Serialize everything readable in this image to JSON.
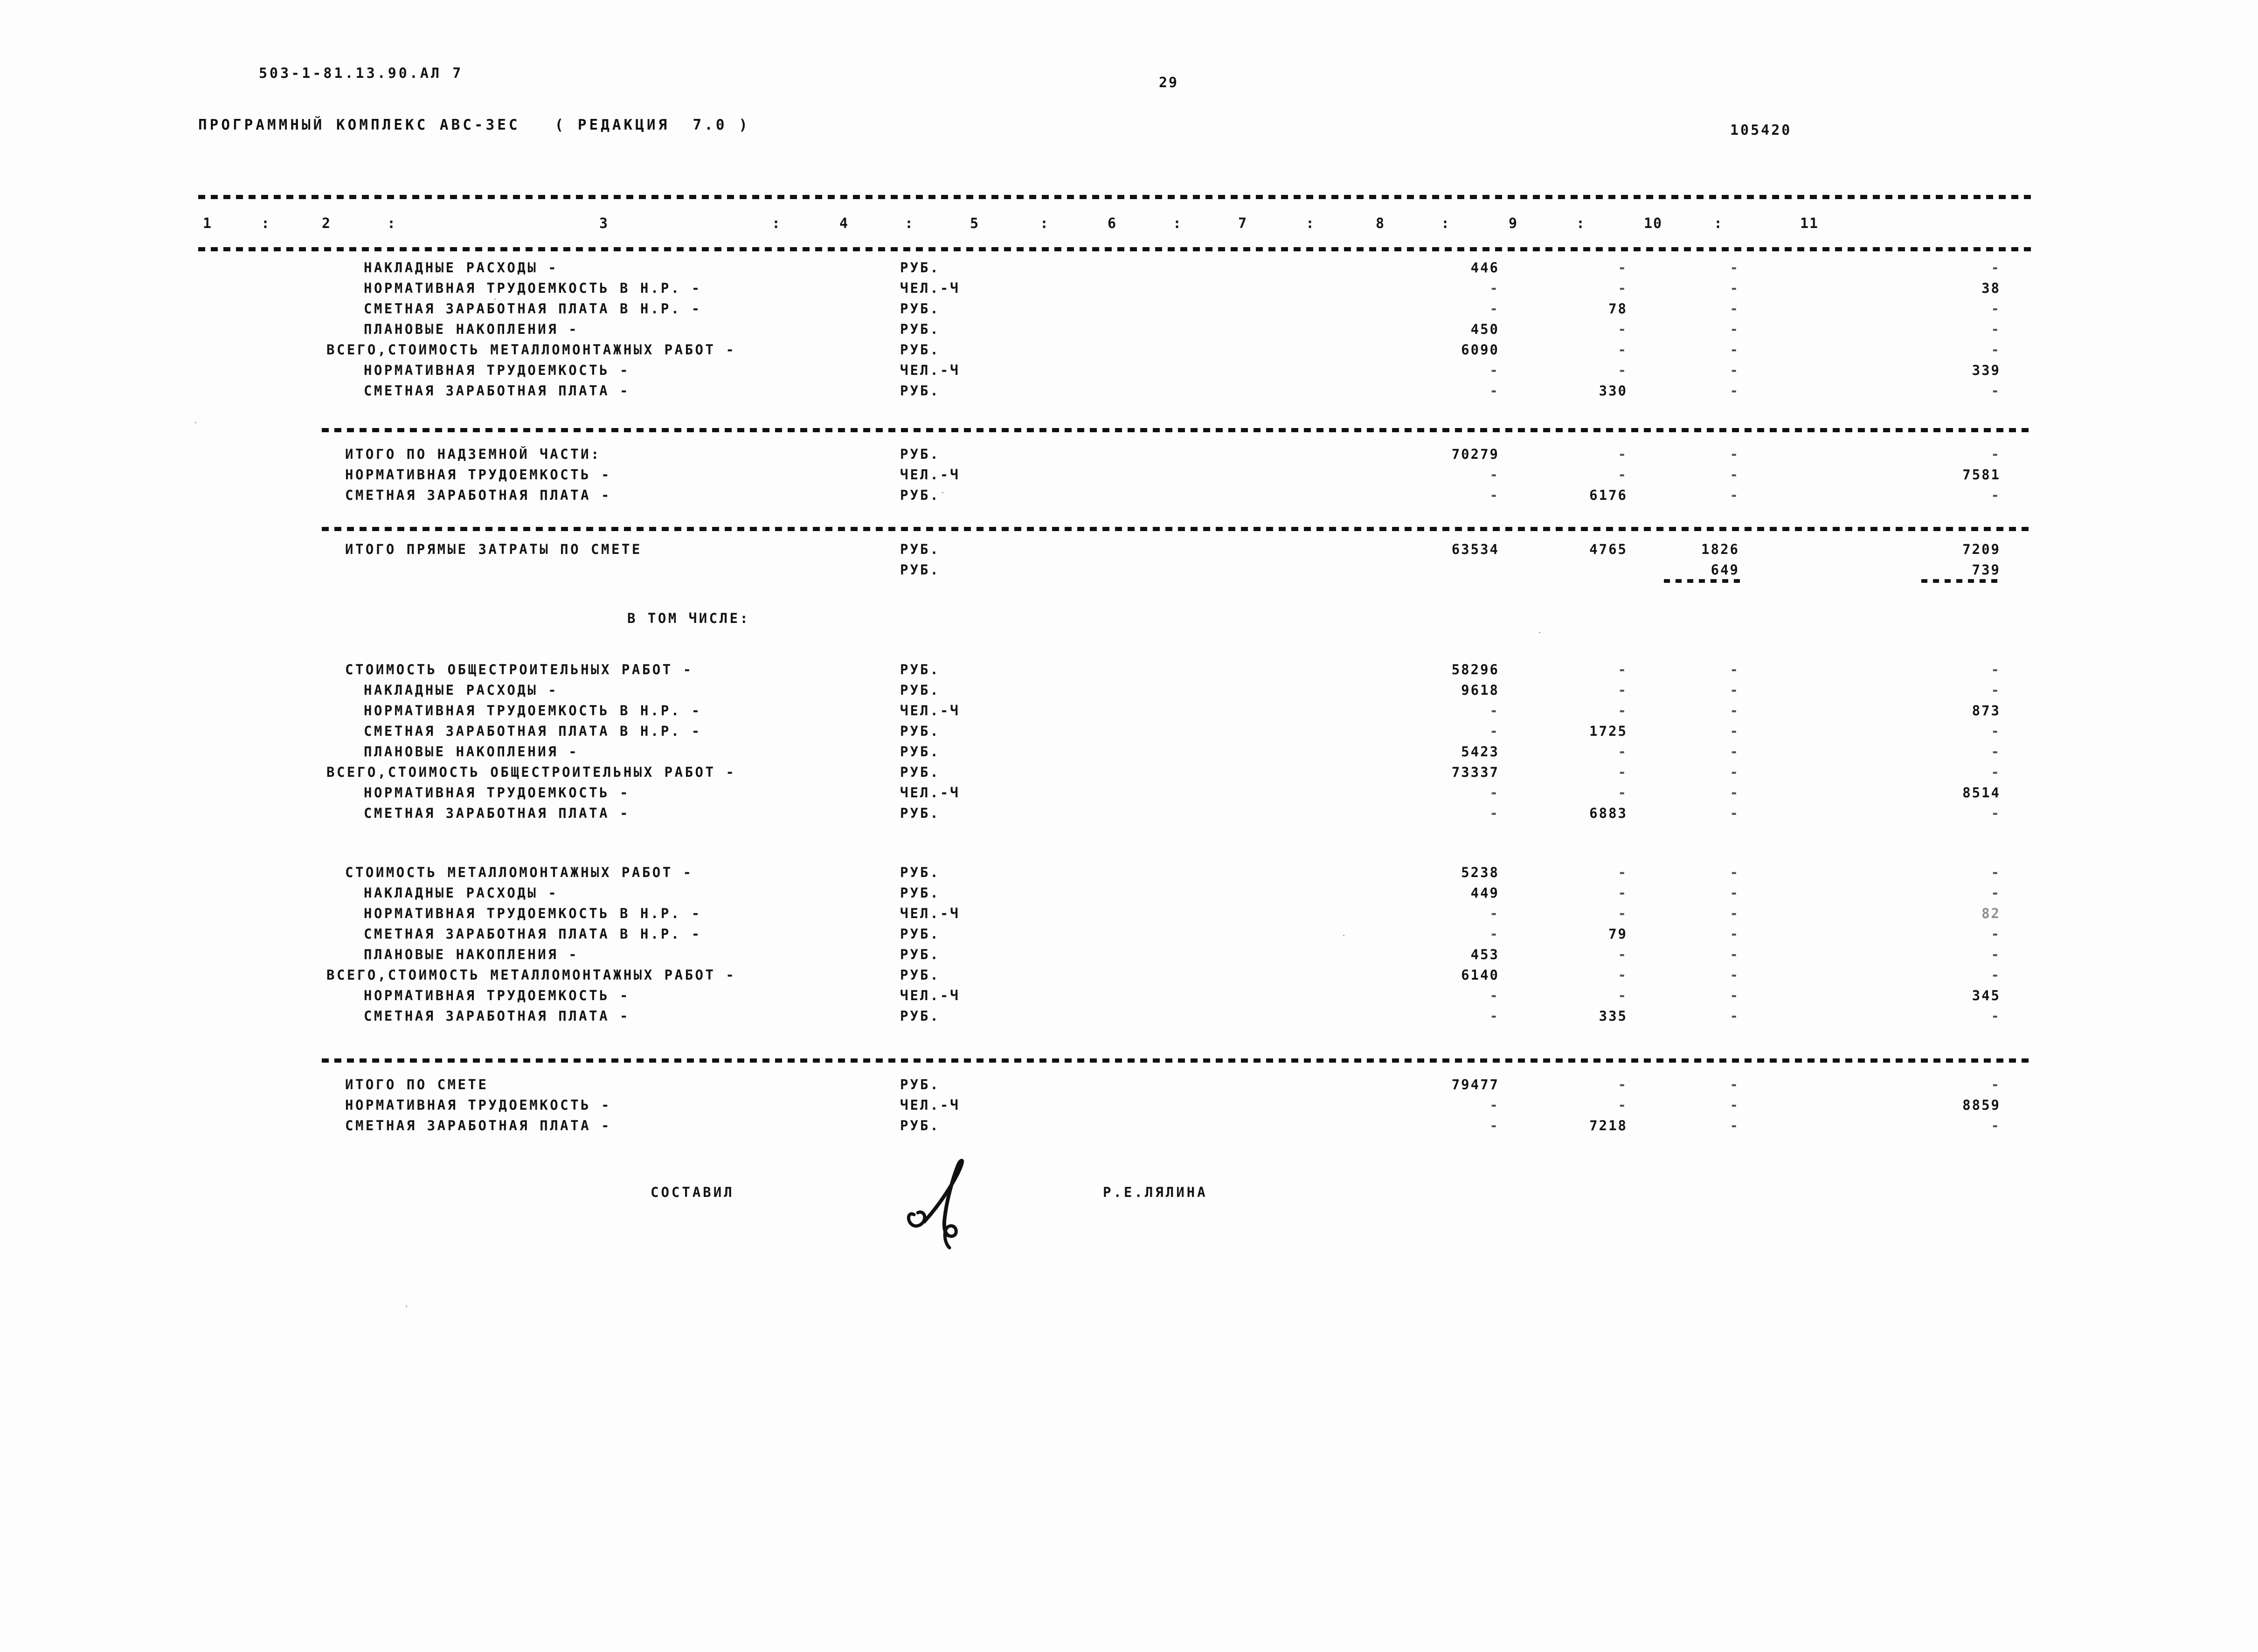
{
  "header": {
    "drawing_code": "503-1-81.13.90.АЛ 7",
    "page_number": "29",
    "program_title": "ПРОГРАММНЫЙ КОМПЛЕКС АВС-ЗЕС   ( РЕДАКЦИЯ  7.0 )",
    "doc_number": "105420"
  },
  "table": {
    "column_headers": [
      "1",
      "2",
      "3",
      "4",
      "5",
      "6",
      "7",
      "8",
      "9",
      "10",
      "11"
    ],
    "column_separator": ":",
    "units": {
      "rub": "РУБ.",
      "chel_ch": "ЧЕЛ.-Ч"
    },
    "empty": "-",
    "rows": [
      {
        "label": "НАКЛАДНЫЕ РАСХОДЫ -",
        "indent": 2,
        "unit": "РУБ.",
        "c7": "446",
        "c8": "-",
        "c9": "-",
        "c11": "-"
      },
      {
        "label": "НОРМАТИВНАЯ ТРУДОЕМКОСТЬ В Н.Р. -",
        "indent": 2,
        "unit": "ЧЕЛ.-Ч",
        "c7": "-",
        "c8": "-",
        "c9": "-",
        "c11": "38"
      },
      {
        "label": "СМЕТНАЯ ЗАРАБОТНАЯ ПЛАТА В Н.Р. -",
        "indent": 2,
        "unit": "РУБ.",
        "c7": "-",
        "c8": "78",
        "c9": "-",
        "c11": "-"
      },
      {
        "label": "ПЛАНОВЫЕ НАКОПЛЕНИЯ -",
        "indent": 2,
        "unit": "РУБ.",
        "c7": "450",
        "c8": "-",
        "c9": "-",
        "c11": "-"
      },
      {
        "label": "ВСЕГО,СТОИМОСТЬ МЕТАЛЛОМОНТАЖНЫХ РАБОТ -",
        "indent": 0,
        "unit": "РУБ.",
        "c7": "6090",
        "c8": "-",
        "c9": "-",
        "c11": "-"
      },
      {
        "label": "НОРМАТИВНАЯ ТРУДОЕМКОСТЬ -",
        "indent": 2,
        "unit": "ЧЕЛ.-Ч",
        "c7": "-",
        "c8": "-",
        "c9": "-",
        "c11": "339"
      },
      {
        "label": "СМЕТНАЯ ЗАРАБОТНАЯ ПЛАТА -",
        "indent": 2,
        "unit": "РУБ.",
        "c7": "-",
        "c8": "330",
        "c9": "-",
        "c11": "-"
      }
    ],
    "subtotal_ground": {
      "rows": [
        {
          "label": "ИТОГО ПО НАДЗЕМНОЙ ЧАСТИ:",
          "indent": 1,
          "unit": "РУБ.",
          "c7": "70279",
          "c8": "-",
          "c9": "-",
          "c11": "-"
        },
        {
          "label": "НОРМАТИВНАЯ ТРУДОЕМКОСТЬ -",
          "indent": 1,
          "unit": "ЧЕЛ.-Ч",
          "c7": "-",
          "c8": "-",
          "c9": "-",
          "c11": "7581"
        },
        {
          "label": "СМЕТНАЯ ЗАРАБОТНАЯ ПЛАТА -",
          "indent": 1,
          "unit": "РУБ.",
          "c7": "-",
          "c8": "6176",
          "c9": "-",
          "c11": "-"
        }
      ]
    },
    "direct_costs": {
      "rows": [
        {
          "label": "ИТОГО ПРЯМЫЕ ЗАТРАТЫ ПО СМЕТЕ",
          "indent": 1,
          "unit": "РУБ.",
          "c7": "63534",
          "c8": "4765",
          "c9": "1826",
          "c11": "7209"
        },
        {
          "label": "",
          "indent": 1,
          "unit": "РУБ.",
          "c7": "",
          "c8": "",
          "c9": "649",
          "c11": "739"
        }
      ]
    },
    "in_which": "В ТОМ ЧИСЛЕ:",
    "general_construction": [
      {
        "label": "СТОИМОСТЬ ОБЩЕСТРОИТЕЛЬНЫХ РАБОТ -",
        "indent": 1,
        "unit": "РУБ.",
        "c7": "58296",
        "c8": "-",
        "c9": "-",
        "c11": "-"
      },
      {
        "label": "НАКЛАДНЫЕ РАСХОДЫ -",
        "indent": 2,
        "unit": "РУБ.",
        "c7": "9618",
        "c8": "-",
        "c9": "-",
        "c11": "-"
      },
      {
        "label": "НОРМАТИВНАЯ ТРУДОЕМКОСТЬ В Н.Р. -",
        "indent": 2,
        "unit": "ЧЕЛ.-Ч",
        "c7": "-",
        "c8": "-",
        "c9": "-",
        "c11": "873"
      },
      {
        "label": "СМЕТНАЯ ЗАРАБОТНАЯ ПЛАТА В Н.Р. -",
        "indent": 2,
        "unit": "РУБ.",
        "c7": "-",
        "c8": "1725",
        "c9": "-",
        "c11": "-"
      },
      {
        "label": "ПЛАНОВЫЕ НАКОПЛЕНИЯ -",
        "indent": 2,
        "unit": "РУБ.",
        "c7": "5423",
        "c8": "-",
        "c9": "-",
        "c11": "-"
      },
      {
        "label": "ВСЕГО,СТОИМОСТЬ ОБЩЕСТРОИТЕЛЬНЫХ РАБОТ -",
        "indent": 0,
        "unit": "РУБ.",
        "c7": "73337",
        "c8": "-",
        "c9": "-",
        "c11": "-"
      },
      {
        "label": "НОРМАТИВНАЯ ТРУДОЕМКОСТЬ -",
        "indent": 2,
        "unit": "ЧЕЛ.-Ч",
        "c7": "-",
        "c8": "-",
        "c9": "-",
        "c11": "8514"
      },
      {
        "label": "СМЕТНАЯ ЗАРАБОТНАЯ ПЛАТА -",
        "indent": 2,
        "unit": "РУБ.",
        "c7": "-",
        "c8": "6883",
        "c9": "-",
        "c11": "-"
      }
    ],
    "metal_assembly": [
      {
        "label": "СТОИМОСТЬ МЕТАЛЛОМОНТАЖНЫХ РАБОТ -",
        "indent": 1,
        "unit": "РУБ.",
        "c7": "5238",
        "c8": "-",
        "c9": "-",
        "c11": "-"
      },
      {
        "label": "НАКЛАДНЫЕ РАСХОДЫ -",
        "indent": 2,
        "unit": "РУБ.",
        "c7": "449",
        "c8": "-",
        "c9": "-",
        "c11": "-"
      },
      {
        "label": "НОРМАТИВНАЯ ТРУДОЕМКОСТЬ В Н.Р. -",
        "indent": 2,
        "unit": "ЧЕЛ.-Ч",
        "c7": "-",
        "c8": "-",
        "c9": "-",
        "c11": "82"
      },
      {
        "label": "СМЕТНАЯ ЗАРАБОТНАЯ ПЛАТА В Н.Р. -",
        "indent": 2,
        "unit": "РУБ.",
        "c7": "-",
        "c8": "79",
        "c9": "-",
        "c11": "-"
      },
      {
        "label": "ПЛАНОВЫЕ НАКОПЛЕНИЯ -",
        "indent": 2,
        "unit": "РУБ.",
        "c7": "453",
        "c8": "-",
        "c9": "-",
        "c11": "-"
      },
      {
        "label": "ВСЕГО,СТОИМОСТЬ МЕТАЛЛОМОНТАЖНЫХ РАБОТ -",
        "indent": 0,
        "unit": "РУБ.",
        "c7": "6140",
        "c8": "-",
        "c9": "-",
        "c11": "-"
      },
      {
        "label": "НОРМАТИВНАЯ ТРУДОЕМКОСТЬ -",
        "indent": 2,
        "unit": "ЧЕЛ.-Ч",
        "c7": "-",
        "c8": "-",
        "c9": "-",
        "c11": "345"
      },
      {
        "label": "СМЕТНАЯ ЗАРАБОТНАЯ ПЛАТА -",
        "indent": 2,
        "unit": "РУБ.",
        "c7": "-",
        "c8": "335",
        "c9": "-",
        "c11": "-"
      }
    ],
    "grand_total": [
      {
        "label": "ИТОГО ПО СМЕТЕ",
        "indent": 1,
        "unit": "РУБ.",
        "c7": "79477",
        "c8": "-",
        "c9": "-",
        "c11": "-"
      },
      {
        "label": "НОРМАТИВНАЯ ТРУДОЕМКОСТЬ -",
        "indent": 1,
        "unit": "ЧЕЛ.-Ч",
        "c7": "-",
        "c8": "-",
        "c9": "-",
        "c11": "8859"
      },
      {
        "label": "СМЕТНАЯ ЗАРАБОТНАЯ ПЛАТА -",
        "indent": 1,
        "unit": "РУБ.",
        "c7": "-",
        "c8": "7218",
        "c9": "-",
        "c11": "-"
      }
    ]
  },
  "footer": {
    "compiled_by_label": "СОСТАВИЛ",
    "compiled_by_name": "Р.Е.ЛЯЛИНА"
  }
}
